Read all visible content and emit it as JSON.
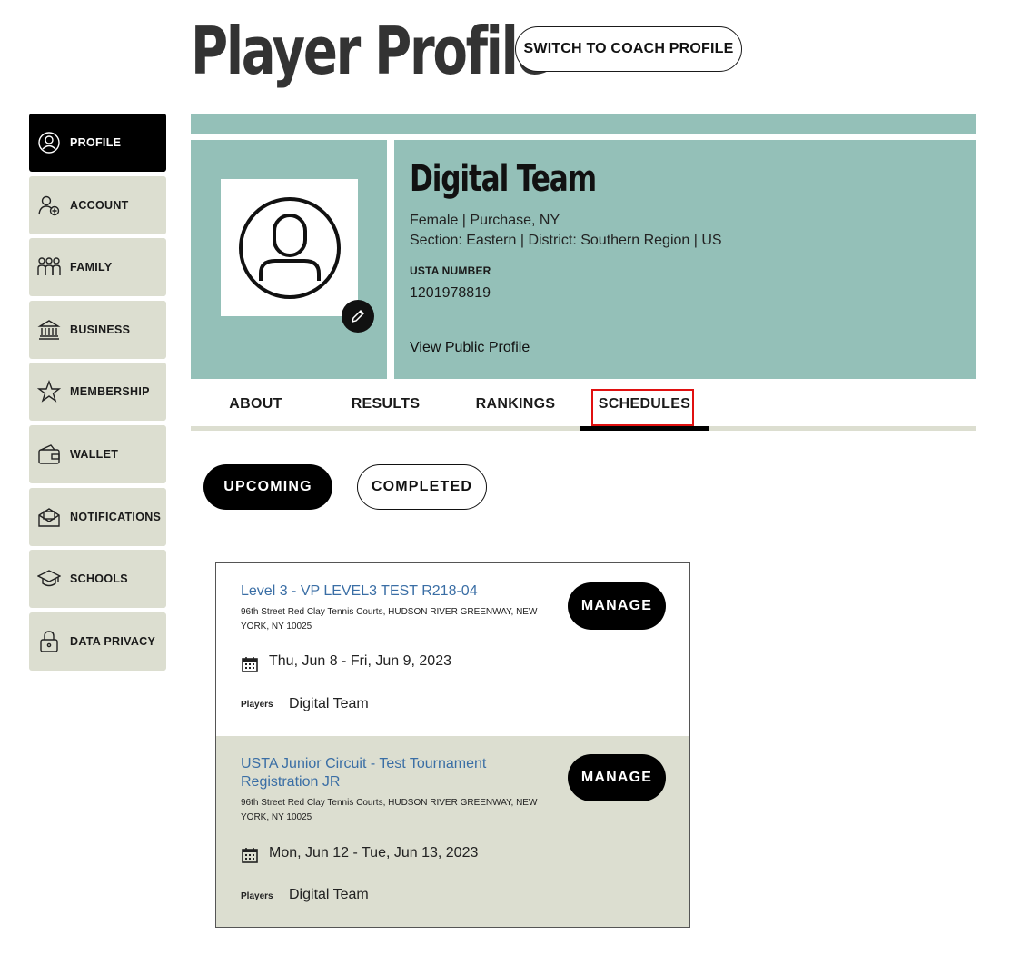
{
  "header": {
    "title": "Player Profile",
    "switch_label": "SWITCH TO COACH PROFILE"
  },
  "sidebar": {
    "items": [
      {
        "label": "PROFILE",
        "icon": "user-circle-icon",
        "active": true
      },
      {
        "label": "ACCOUNT",
        "icon": "user-add-icon",
        "active": false
      },
      {
        "label": "FAMILY",
        "icon": "family-icon",
        "active": false
      },
      {
        "label": "BUSINESS",
        "icon": "bank-icon",
        "active": false
      },
      {
        "label": "MEMBERSHIP",
        "icon": "star-icon",
        "active": false
      },
      {
        "label": "WALLET",
        "icon": "wallet-icon",
        "active": false
      },
      {
        "label": "NOTIFICATIONS",
        "icon": "envelope-icon",
        "active": false
      },
      {
        "label": "SCHOOLS",
        "icon": "graduation-cap-icon",
        "active": false
      },
      {
        "label": "DATA PRIVACY",
        "icon": "lock-icon",
        "active": false
      }
    ]
  },
  "profile": {
    "name": "Digital Team",
    "details": "Female | Purchase, NY",
    "section": "Section: Eastern | District: Southern Region | US",
    "usta_label": "USTA NUMBER",
    "usta_number": "1201978819",
    "public_link": "View Public Profile"
  },
  "tabs": [
    {
      "label": "ABOUT"
    },
    {
      "label": "RESULTS"
    },
    {
      "label": "RANKINGS"
    },
    {
      "label": "SCHEDULES",
      "active": true
    }
  ],
  "filters": {
    "upcoming": "UPCOMING",
    "completed": "COMPLETED"
  },
  "events": [
    {
      "title": "Level 3 - VP LEVEL3 TEST R218-04",
      "address": "96th Street Red Clay Tennis Courts, HUDSON RIVER GREENWAY, NEW YORK, NY 10025",
      "dates": "Thu, Jun 8 - Fri, Jun 9, 2023",
      "players_label": "Players",
      "players": "Digital Team",
      "manage_label": "MANAGE"
    },
    {
      "title": "USTA Junior Circuit - Test Tournament Registration JR",
      "address": "96th Street Red Clay Tennis Courts, HUDSON RIVER GREENWAY, NEW YORK, NY 10025",
      "dates": "Mon, Jun 12 - Tue, Jun 13, 2023",
      "players_label": "Players",
      "players": "Digital Team",
      "manage_label": "MANAGE"
    }
  ],
  "colors": {
    "accent": "#94c0b8",
    "sidebar_bg": "#dcded0",
    "link": "#3a6ea5",
    "highlight": "#e01010"
  }
}
